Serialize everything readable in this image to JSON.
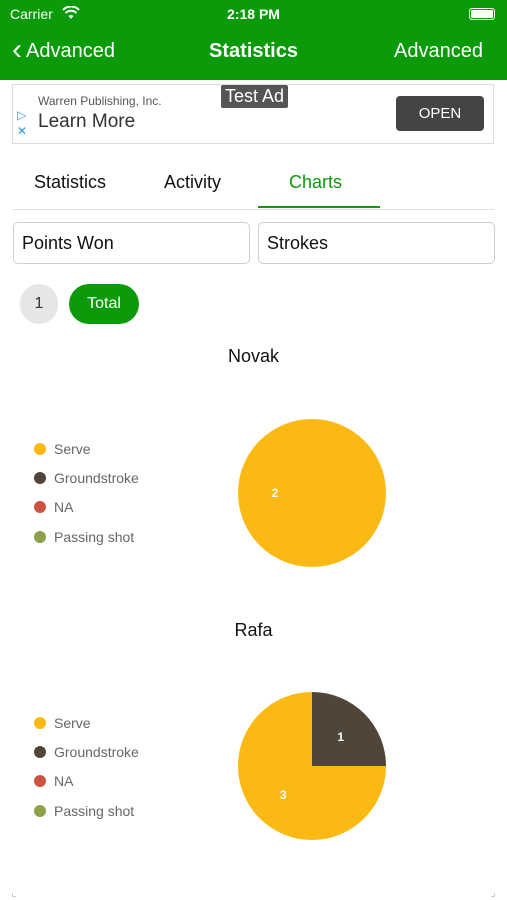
{
  "status": {
    "carrier": "Carrier",
    "time": "2:18 PM"
  },
  "nav": {
    "back_label": "Advanced",
    "title": "Statistics",
    "right_label": "Advanced"
  },
  "ad": {
    "publisher": "Warren Publishing, Inc.",
    "headline": "Learn More",
    "test_label": "Test Ad",
    "open_label": "OPEN"
  },
  "tabs": [
    {
      "label": "Statistics"
    },
    {
      "label": "Activity"
    },
    {
      "label": "Charts"
    }
  ],
  "selectors": {
    "metric": "Points Won",
    "breakdown": "Strokes"
  },
  "pills": {
    "set": "1",
    "total": "Total"
  },
  "colors": {
    "accent": "#0a9a0a",
    "serve": "#fbb913",
    "groundstroke": "#4f4538",
    "na": "#cd5243",
    "passing": "#8da14a"
  },
  "chart_data": [
    {
      "type": "pie",
      "title": "Novak",
      "categories": [
        "Serve",
        "Groundstroke",
        "NA",
        "Passing shot"
      ],
      "values": [
        2,
        0,
        0,
        0
      ],
      "legend": "left"
    },
    {
      "type": "pie",
      "title": "Rafa",
      "categories": [
        "Serve",
        "Groundstroke",
        "NA",
        "Passing shot"
      ],
      "values": [
        3,
        1,
        0,
        0
      ],
      "legend": "left"
    }
  ]
}
